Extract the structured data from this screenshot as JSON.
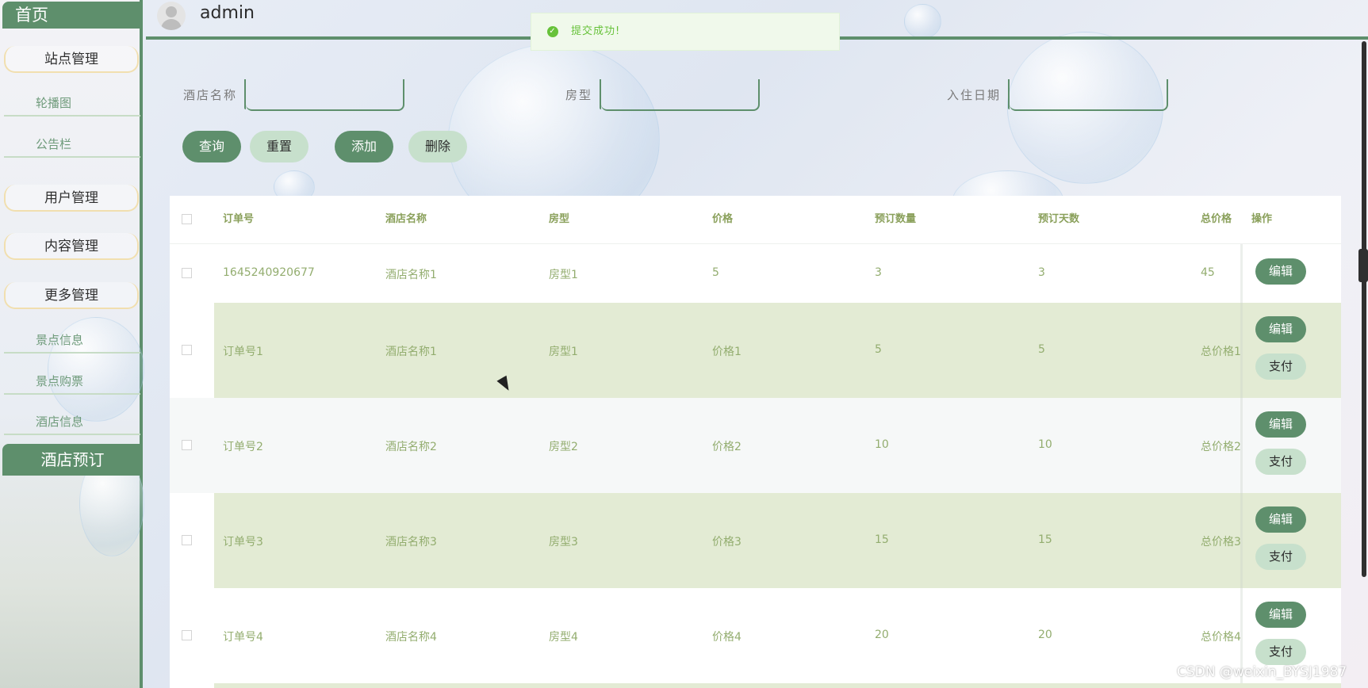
{
  "sidebar": {
    "home": "首页",
    "groups": [
      {
        "label": "站点管理",
        "subs": [
          "轮播图",
          "公告栏"
        ]
      },
      {
        "label": "用户管理",
        "subs": []
      },
      {
        "label": "内容管理",
        "subs": []
      },
      {
        "label": "更多管理",
        "subs": [
          "景点信息",
          "景点购票",
          "酒店信息"
        ]
      }
    ],
    "active": "酒店预订"
  },
  "header": {
    "username": "admin"
  },
  "toast": {
    "message": "提交成功!"
  },
  "search": {
    "hotel_label": "酒店名称",
    "hotel_value": "",
    "room_label": "房型",
    "room_value": "",
    "date_label": "入住日期",
    "date_value": ""
  },
  "actions": {
    "query": "查询",
    "reset": "重置",
    "add": "添加",
    "delete": "删除"
  },
  "table": {
    "columns": [
      "订单号",
      "酒店名称",
      "房型",
      "价格",
      "预订数量",
      "预订天数",
      "总价格",
      "操作"
    ],
    "rows": [
      {
        "order": "1645240920677",
        "hotel": "酒店名称1",
        "room": "房型1",
        "price": "5",
        "qty": "3",
        "days": "3",
        "total": "45",
        "has_pay": false
      },
      {
        "order": "订单号1",
        "hotel": "酒店名称1",
        "room": "房型1",
        "price": "价格1",
        "qty": "5",
        "days": "5",
        "total": "总价格1",
        "has_pay": true
      },
      {
        "order": "订单号2",
        "hotel": "酒店名称2",
        "room": "房型2",
        "price": "价格2",
        "qty": "10",
        "days": "10",
        "total": "总价格2",
        "has_pay": true
      },
      {
        "order": "订单号3",
        "hotel": "酒店名称3",
        "room": "房型3",
        "price": "价格3",
        "qty": "15",
        "days": "15",
        "total": "总价格3",
        "has_pay": true
      },
      {
        "order": "订单号4",
        "hotel": "酒店名称4",
        "room": "房型4",
        "price": "价格4",
        "qty": "20",
        "days": "20",
        "total": "总价格4",
        "has_pay": true
      }
    ],
    "edit_label": "编辑",
    "pay_label": "支付"
  },
  "watermark": "CSDN @weixin_BYSJ1987",
  "colors": {
    "primary": "#5e8f6c",
    "light": "#c7e0cc",
    "stripe": "#e3ebd4",
    "text_green": "#93ad6f",
    "toast_bg": "#f0f9eb"
  }
}
